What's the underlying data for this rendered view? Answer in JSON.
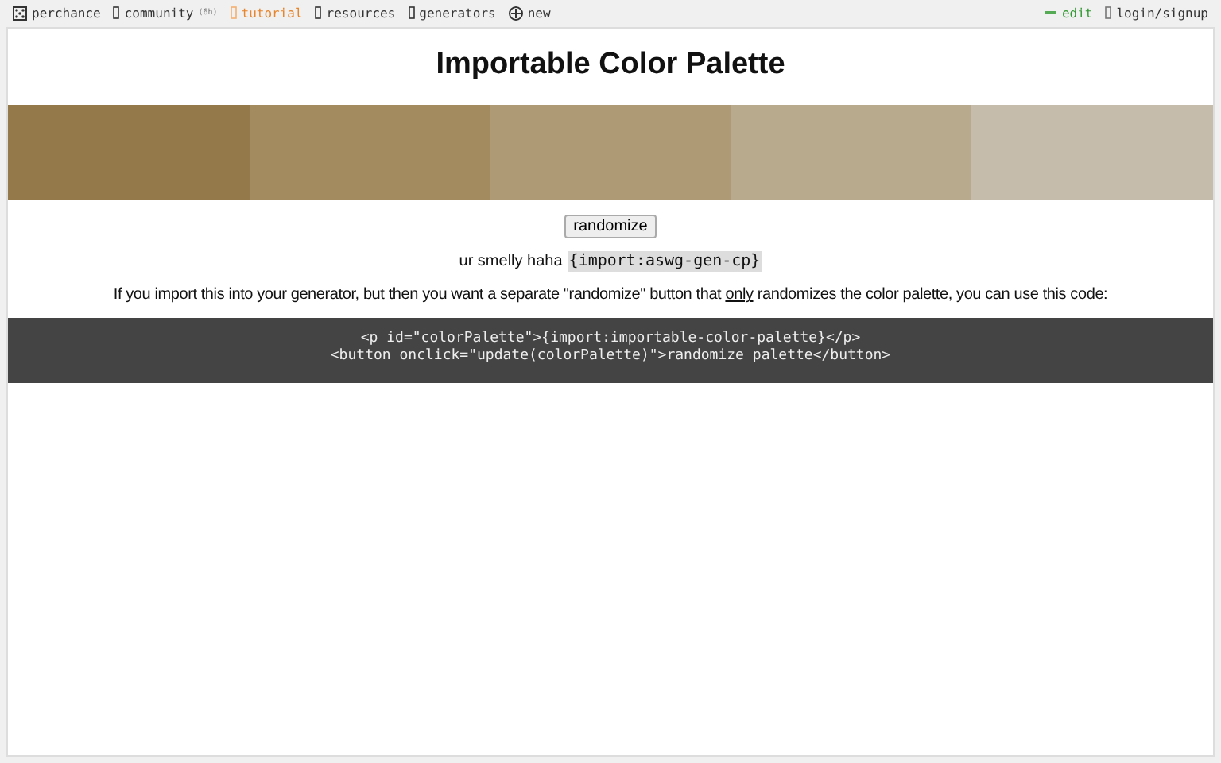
{
  "nav": {
    "items": [
      {
        "label": "perchance",
        "kind": "dice",
        "selected": false
      },
      {
        "label": "community",
        "kind": "box",
        "selected": false,
        "badge": "(6h)"
      },
      {
        "label": "tutorial",
        "kind": "box",
        "selected": true
      },
      {
        "label": "resources",
        "kind": "box",
        "selected": false
      },
      {
        "label": "generators",
        "kind": "box",
        "selected": false
      },
      {
        "label": "new",
        "kind": "plus",
        "selected": false
      }
    ],
    "right": [
      {
        "label": "edit",
        "kind": "pencil"
      },
      {
        "label": "login/signup",
        "kind": "box"
      }
    ]
  },
  "title": "Importable Color Palette",
  "palette": [
    {
      "color": "#947a4a"
    },
    {
      "color": "#a38b5f"
    },
    {
      "color": "#ae9a74"
    },
    {
      "color": "#b8aa8c"
    },
    {
      "color": "#c6bcac"
    }
  ],
  "button": "randomize",
  "line": {
    "text": "ur smelly haha",
    "code": "{import:aswg-gen-cp}"
  },
  "note": "If you import this into your generator, but then you want a separate \"randomize\" button that *only* randomizes the color palette, you can use this code:",
  "code": [
    "<p id=\"colorPalette\">{import:importable-color-palette}</p>",
    "<button onclick=\"update(colorPalette)\">randomize palette</button>"
  ]
}
